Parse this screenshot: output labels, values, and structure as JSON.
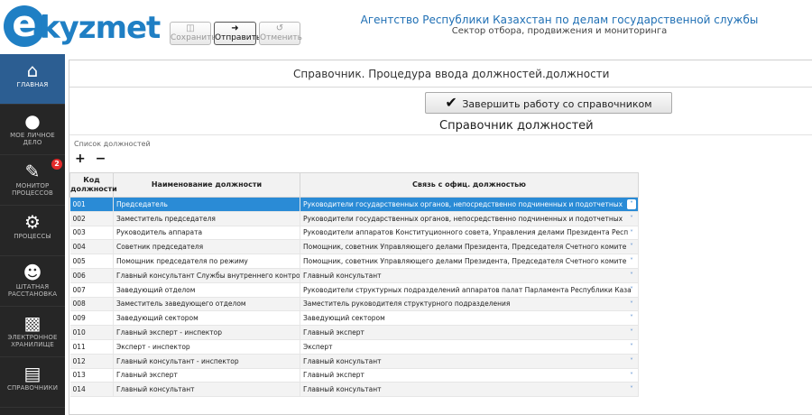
{
  "brand": {
    "logo_e": "e",
    "logo_text": "kyzmet"
  },
  "toolbar": {
    "save_label": "Сохранить",
    "send_label": "Отправить",
    "cancel_label": "Отменить"
  },
  "agency": {
    "title": "Агентство Республики Казахстан по делам государственной службы",
    "subtitle": "Сектор отбора, продвижения и мониторинга"
  },
  "sidebar": {
    "items": [
      {
        "label": "ГЛАВНАЯ",
        "icon": "home-icon"
      },
      {
        "label": "МОЕ ЛИЧНОЕ ДЕЛО",
        "icon": "user-icon"
      },
      {
        "label": "МОНИТОР ПРОЦЕССОВ",
        "icon": "edit-icon",
        "badge": "2"
      },
      {
        "label": "ПРОЦЕССЫ",
        "icon": "gears-icon"
      },
      {
        "label": "ШТАТНАЯ РАССТАНОВКА",
        "icon": "people-icon"
      },
      {
        "label": "ЭЛЕКТРОННОЕ ХРАНИЛИЩЕ",
        "icon": "inbox-icon"
      },
      {
        "label": "СПРАВОЧНИКИ",
        "icon": "book-icon"
      }
    ]
  },
  "main": {
    "breadcrumb": "Справочник. Процедура ввода должностей.должности",
    "finish_button": "Завершить работу со справочником",
    "title": "Справочник должностей",
    "list_label": "Список должностей",
    "add_symbol": "+",
    "remove_symbol": "−"
  },
  "table": {
    "headers": {
      "code": "Код должности",
      "name": "Наименование должности",
      "assoc": "Связь с офиц. должностью"
    },
    "rows": [
      [
        "001",
        "Председатель",
        "Руководители государственных органов, непосредственно подчиненных и подотчетных"
      ],
      [
        "002",
        "Заместитель председателя",
        "Руководители государственных органов, непосредственно подчиненных и подотчетных"
      ],
      [
        "003",
        "Руководитель аппарата",
        "Руководители аппаратов Конституционного совета, Управления делами Президента Респ"
      ],
      [
        "004",
        "Советник председателя",
        "Помощник, советник Управляющего делами Президента, Председателя Счетного комите"
      ],
      [
        "005",
        "Помощник председателя по режиму",
        "Помощник, советник Управляющего делами Президента, Председателя Счетного комите"
      ],
      [
        "006",
        "Главный консультант Службы внутреннего контро",
        "Главный консультант"
      ],
      [
        "007",
        "Заведующий отделом",
        "Руководители структурных подразделений аппаратов палат Парламента Республики Каза"
      ],
      [
        "008",
        "Заместитель заведующего отделом",
        "Заместитель руководителя структурного подразделения"
      ],
      [
        "009",
        "Заведующий сектором",
        "Заведующий сектором"
      ],
      [
        "010",
        "Главный эксперт - инспектор",
        "Главный эксперт"
      ],
      [
        "011",
        "Эксперт - инспектор",
        "Эксперт"
      ],
      [
        "012",
        "Главный консультант - инспектор",
        "Главный консультант"
      ],
      [
        "013",
        "Главный эксперт",
        "Главный эксперт"
      ],
      [
        "014",
        "Главный консультант",
        "Главный консультант"
      ]
    ]
  },
  "colors": {
    "accent": "#1f7fc4",
    "selected_row": "#2a8bd6",
    "sidebar_bg": "#262626",
    "badge": "#e32b2b"
  }
}
